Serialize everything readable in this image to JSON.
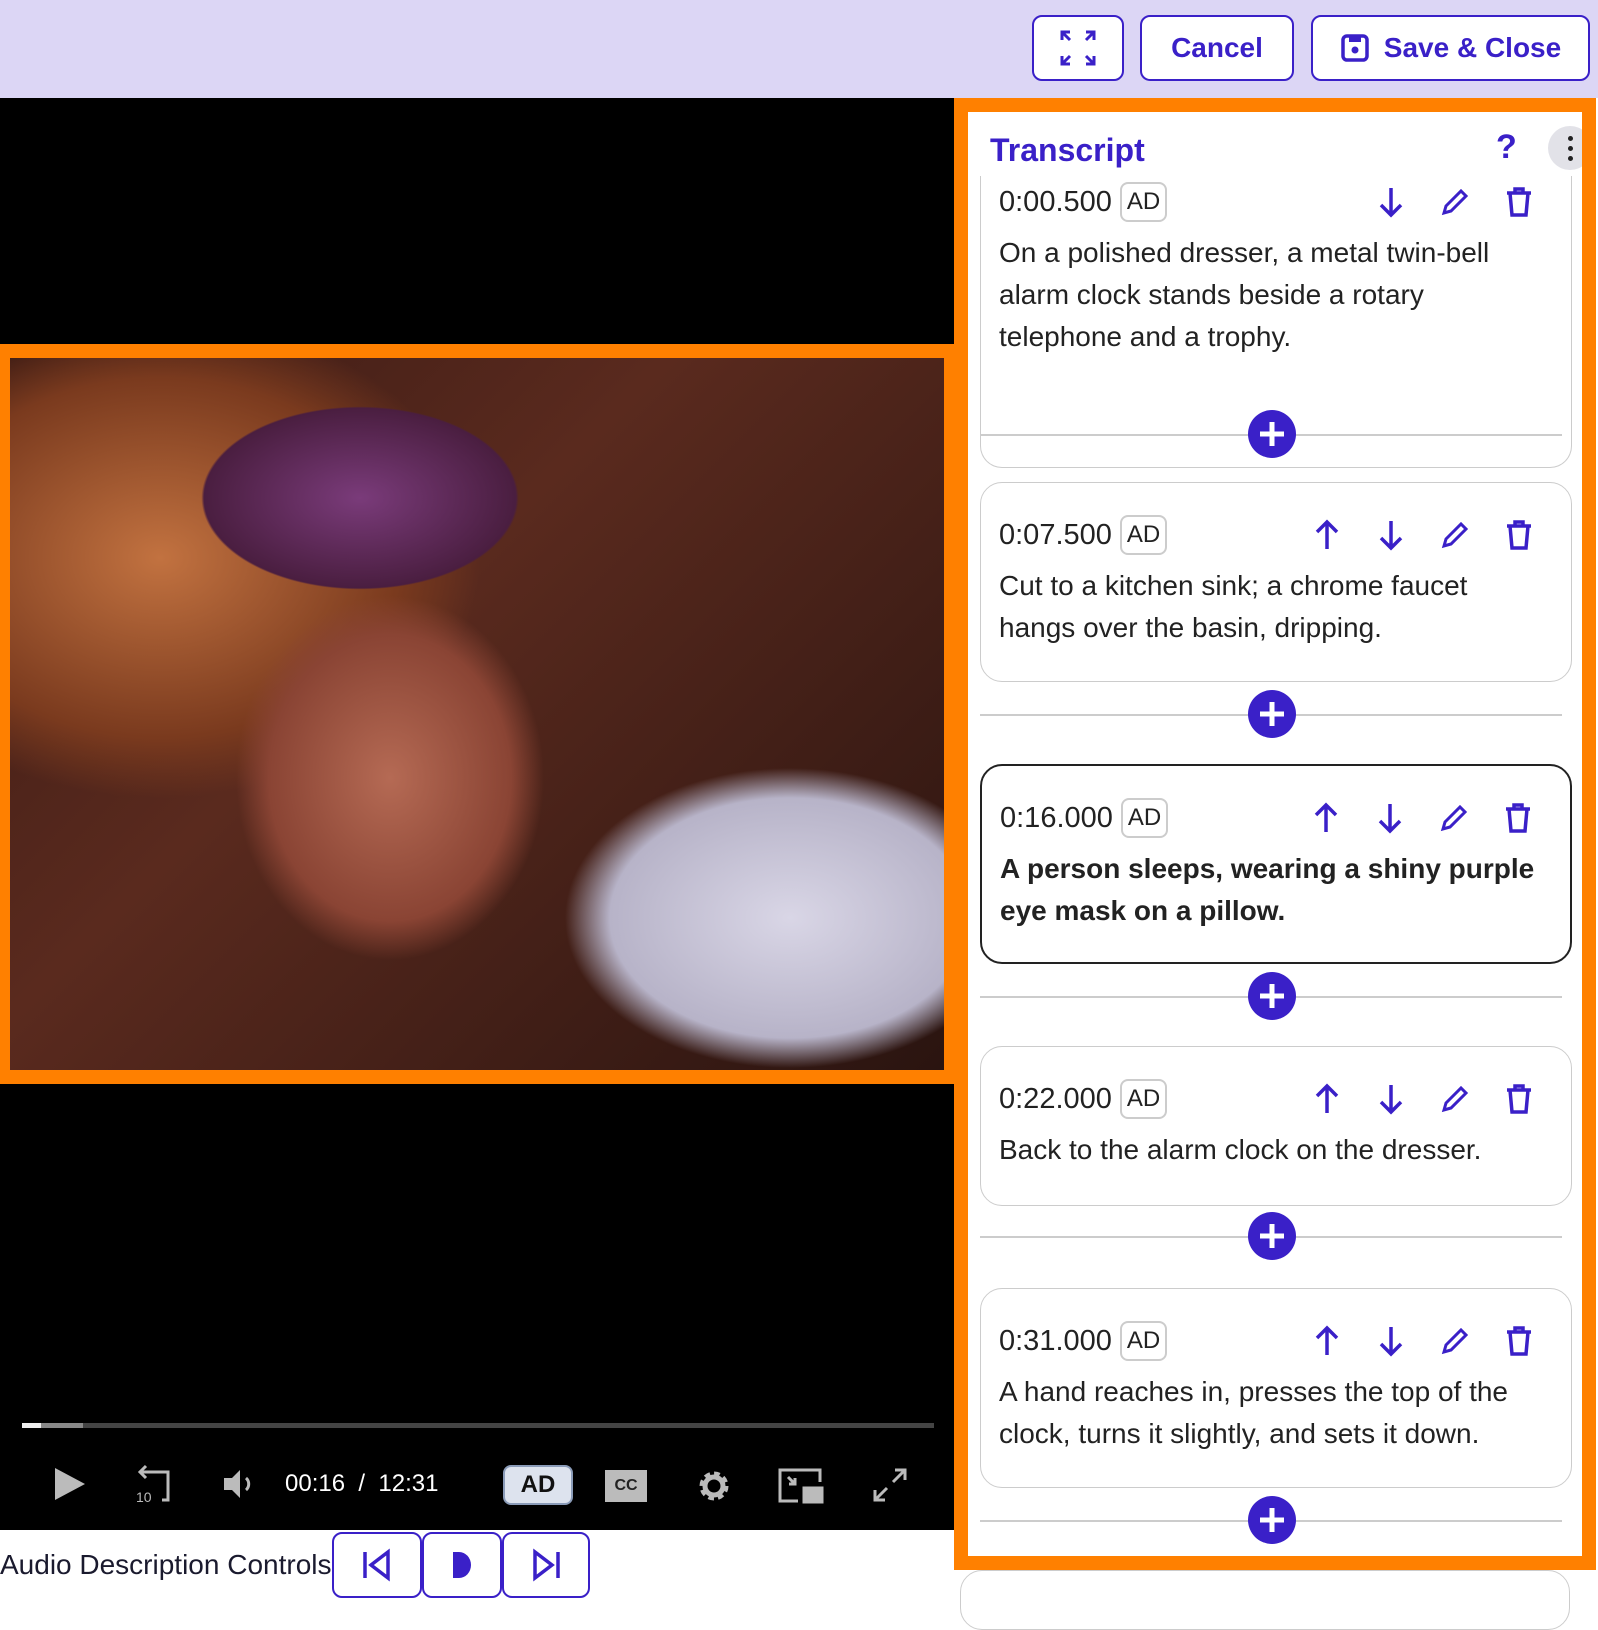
{
  "topbar": {
    "expand_icon": "expand-icon",
    "cancel_label": "Cancel",
    "save_label": "Save & Close",
    "save_icon": "save-icon"
  },
  "player": {
    "current_time": "00:16",
    "separator": "/",
    "duration": "12:31",
    "progress_fraction": 0.0213,
    "buffered_fraction": 0.067,
    "ad_label": "AD",
    "cc_label": "CC",
    "rewind_label": "10"
  },
  "ad_controls": {
    "label": "Audio Description Controls"
  },
  "transcript": {
    "title": "Transcript",
    "help": "?",
    "entries": [
      {
        "time": "0:00.500",
        "badge": "AD",
        "text": "On a polished dresser, a metal twin-bell alarm clock stands beside a rotary telephone and a trophy."
      },
      {
        "time": "0:07.500",
        "badge": "AD",
        "text": "Cut to a kitchen sink; a chrome faucet hangs over the basin, dripping."
      },
      {
        "time": "0:16.000",
        "badge": "AD",
        "text": "A person sleeps, wearing a shiny purple eye mask on a pillow."
      },
      {
        "time": "0:22.000",
        "badge": "AD",
        "text": "Back to the alarm clock on the dresser."
      },
      {
        "time": "0:31.000",
        "badge": "AD",
        "text": "A hand reaches in, presses the top of the clock, turns it slightly, and sets it down."
      }
    ]
  },
  "colors": {
    "accent": "#3a20c8",
    "highlight": "#ff8000",
    "topbar": "#dcd6f5"
  }
}
